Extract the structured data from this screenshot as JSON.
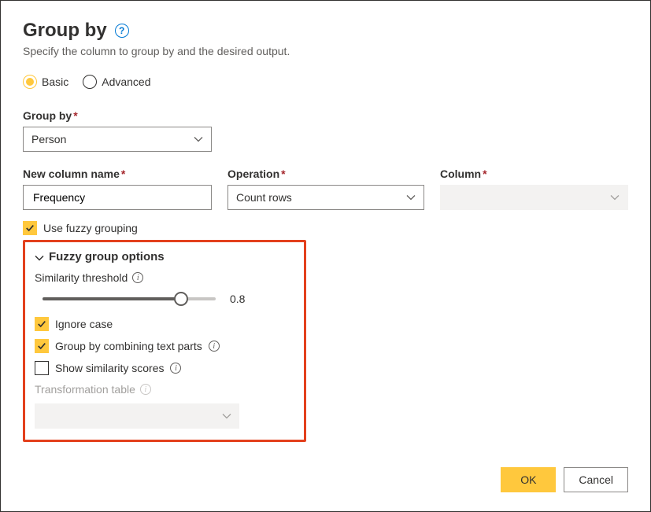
{
  "title": "Group by",
  "subtitle": "Specify the column to group by and the desired output.",
  "mode": {
    "basic_label": "Basic",
    "advanced_label": "Advanced",
    "selected": "basic"
  },
  "groupby": {
    "label": "Group by",
    "value": "Person"
  },
  "newcol": {
    "label": "New column name",
    "value": "Frequency"
  },
  "operation": {
    "label": "Operation",
    "value": "Count rows"
  },
  "column": {
    "label": "Column",
    "value": ""
  },
  "fuzzy": {
    "use_label": "Use fuzzy grouping",
    "use_checked": true,
    "section_label": "Fuzzy group options",
    "similarity_label": "Similarity threshold",
    "similarity_value": "0.8",
    "similarity_pct": 80,
    "ignore_case_label": "Ignore case",
    "ignore_case_checked": true,
    "combine_label": "Group by combining text parts",
    "combine_checked": true,
    "scores_label": "Show similarity scores",
    "scores_checked": false,
    "tt_label": "Transformation table",
    "tt_value": ""
  },
  "footer": {
    "ok": "OK",
    "cancel": "Cancel"
  }
}
